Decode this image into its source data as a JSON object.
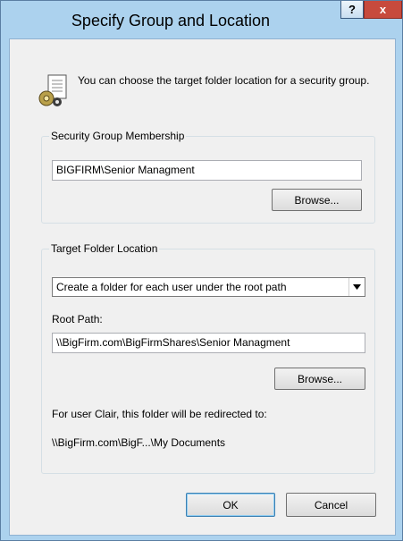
{
  "window": {
    "title": "Specify Group and Location",
    "help_label": "?",
    "close_label": "x"
  },
  "intro": {
    "text": "You can choose the target folder location for a security group."
  },
  "membership": {
    "legend": "Security Group Membership",
    "group_value": "BIGFIRM\\Senior Managment",
    "browse_label": "Browse..."
  },
  "target": {
    "legend": "Target Folder Location",
    "option_selected": "Create a folder for each user under the root path",
    "root_path_label": "Root Path:",
    "root_path_value": "\\\\BigFirm.com\\BigFirmShares\\Senior Managment",
    "browse_label": "Browse...",
    "redirect_note": "For user Clair, this folder will be redirected to:",
    "redirect_path": "\\\\BigFirm.com\\BigF...\\My Documents"
  },
  "footer": {
    "ok_label": "OK",
    "cancel_label": "Cancel"
  }
}
